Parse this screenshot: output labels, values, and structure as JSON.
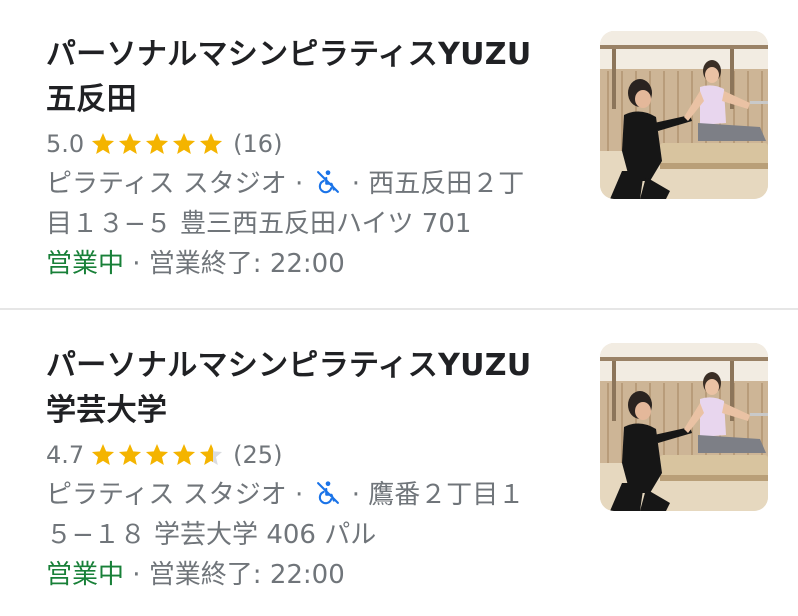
{
  "results": [
    {
      "title_line1": "パーソナルマシンピラティスYUZU",
      "title_line2": "五反田",
      "rating": "5.0",
      "stars": [
        1,
        1,
        1,
        1,
        1
      ],
      "review_count": "(16)",
      "category": "ピラティス スタジオ ·",
      "address_tail": "· 西五反田２丁",
      "address_line2": "目１３−５ 豊三西五反田ハイツ 701",
      "status": "営業中",
      "hours": " · 営業終了: 22:00",
      "accessibility_icon": "wheelchair-inaccessible-icon",
      "thumbnail_icon": "pilates-studio-photo"
    },
    {
      "title_line1": "パーソナルマシンピラティスYUZU",
      "title_line2": "学芸大学",
      "rating": "4.7",
      "stars": [
        1,
        1,
        1,
        1,
        0.6
      ],
      "review_count": "(25)",
      "category": "ピラティス スタジオ ·",
      "address_tail": "· 鷹番２丁目１",
      "address_line2": "５−１８ 学芸大学 406 パル",
      "status": "営業中",
      "hours": " · 営業終了: 22:00",
      "accessibility_icon": "wheelchair-inaccessible-icon",
      "thumbnail_icon": "pilates-studio-photo"
    }
  ],
  "colors": {
    "star": "#f4b400",
    "star_empty": "#dadce0",
    "open": "#188038",
    "accessibility": "#1a73e8",
    "secondary_text": "#70757a",
    "title_text": "#202124"
  }
}
